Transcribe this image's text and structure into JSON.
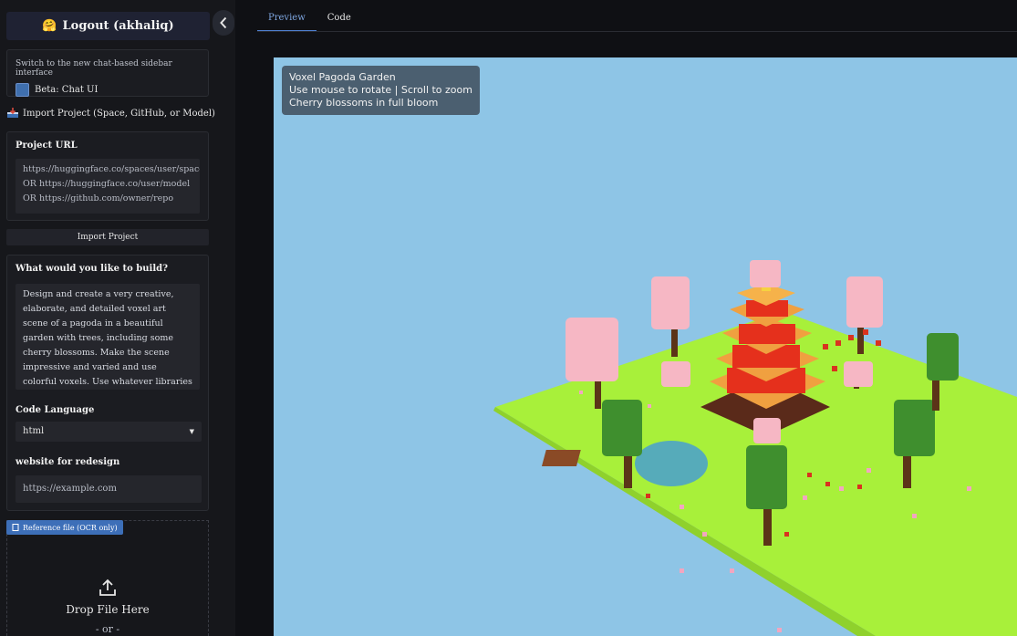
{
  "sidebar": {
    "logout_label": "Logout (akhaliq)",
    "logout_emoji": "🤗",
    "collapse_icon": "chevron-left-icon",
    "beta_hint": "Switch to the new chat-based sidebar interface",
    "beta_checkbox_label": "Beta: Chat UI",
    "import_heading": "Import Project (Space, GitHub, or Model)",
    "project_url": {
      "label": "Project URL",
      "placeholder": "https://huggingface.co/spaces/user/space OR https://huggingface.co/user/model OR https://github.com/owner/repo"
    },
    "import_button": "Import Project",
    "prompt": {
      "label": "What would you like to build?",
      "value": "Design and create a very creative, elaborate, and detailed voxel art scene of a pagoda in a beautiful garden with trees, including some cherry blossoms. Make the scene impressive and varied and use colorful voxels. Use whatever libraries to get this done"
    },
    "code_language": {
      "label": "Code Language",
      "value": "html"
    },
    "redesign": {
      "label": "website for redesign",
      "placeholder": "https://example.com"
    },
    "reference_file_label": "Reference file (OCR only)",
    "drop_text": "Drop File Here",
    "or_text": "- or -"
  },
  "tabs": [
    {
      "label": "Preview",
      "active": true
    },
    {
      "label": "Code",
      "active": false
    }
  ],
  "preview": {
    "info_lines": [
      "Voxel Pagoda Garden",
      "Use mouse to rotate | Scroll to zoom",
      "Cherry blossoms in full bloom"
    ],
    "sky_color": "#8ec5e6",
    "grass_color": "#a8f03a"
  },
  "colors": {
    "accent": "#4f7fd1",
    "checkbox": "#3f6fae"
  }
}
